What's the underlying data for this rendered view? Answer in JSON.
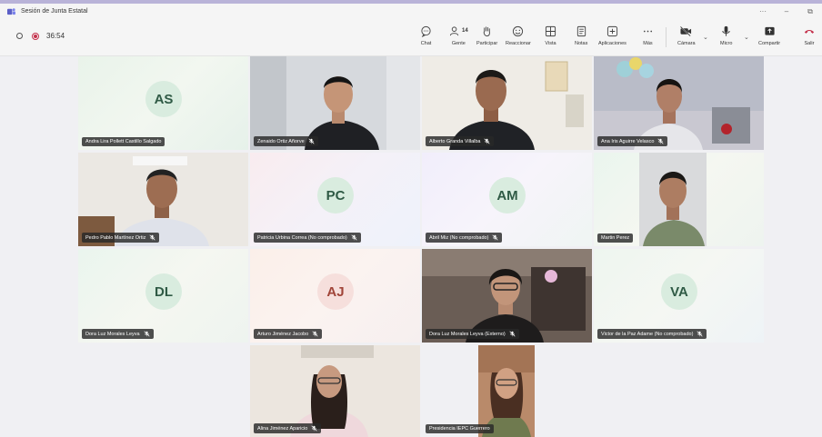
{
  "window": {
    "title": "Sesión de Junta Estatal",
    "controls": [
      "···",
      "–",
      "⧉"
    ]
  },
  "meeting": {
    "timer": "36:54"
  },
  "toolbar": [
    {
      "id": "chat",
      "label": "Chat"
    },
    {
      "id": "people",
      "label": "Gente",
      "count": "14"
    },
    {
      "id": "raise",
      "label": "Participar"
    },
    {
      "id": "react",
      "label": "Reaccionar"
    },
    {
      "id": "view",
      "label": "Vista"
    },
    {
      "id": "notes",
      "label": "Notas"
    },
    {
      "id": "apps",
      "label": "Aplicaciones"
    },
    {
      "id": "more",
      "label": "Más"
    },
    {
      "id": "camera",
      "label": "Cámara"
    },
    {
      "id": "mic",
      "label": "Micro"
    },
    {
      "id": "share",
      "label": "Compartir"
    },
    {
      "id": "leave",
      "label": "Salir"
    }
  ],
  "participants": [
    {
      "name": "Andra Lira Pollett Castillo Salgado",
      "initials": "AS",
      "muted": false
    },
    {
      "name": "Zenaido Ortiz Añorve",
      "initials": "",
      "muted": true
    },
    {
      "name": "Alberto Granda Villalba",
      "initials": "",
      "muted": true
    },
    {
      "name": "Ana Iris Aguirre Velasco",
      "initials": "",
      "muted": true
    },
    {
      "name": "Pedro Pablo Martínez Ortiz",
      "initials": "",
      "muted": true
    },
    {
      "name": "Patricia Urbina Correa (No comprobado)",
      "initials": "PC",
      "muted": true
    },
    {
      "name": "Abril Miz (No comprobado)",
      "initials": "AM",
      "muted": true
    },
    {
      "name": "Martin Perez",
      "initials": "",
      "muted": false
    },
    {
      "name": "Dora Luz Morales Leyva",
      "initials": "DL",
      "muted": true
    },
    {
      "name": "Arturo Jiménez Jacobo",
      "initials": "AJ",
      "muted": true
    },
    {
      "name": "Dora Luz Morales Leyva (Externo)",
      "initials": "",
      "muted": true
    },
    {
      "name": "Victor de la Paz Adame (No comprobado)",
      "initials": "VA",
      "muted": true
    },
    {
      "name": "Alina Jiménez Aparicio",
      "initials": "",
      "muted": true
    },
    {
      "name": "Presidencia IEPC Guerrero",
      "initials": "",
      "muted": false
    }
  ]
}
